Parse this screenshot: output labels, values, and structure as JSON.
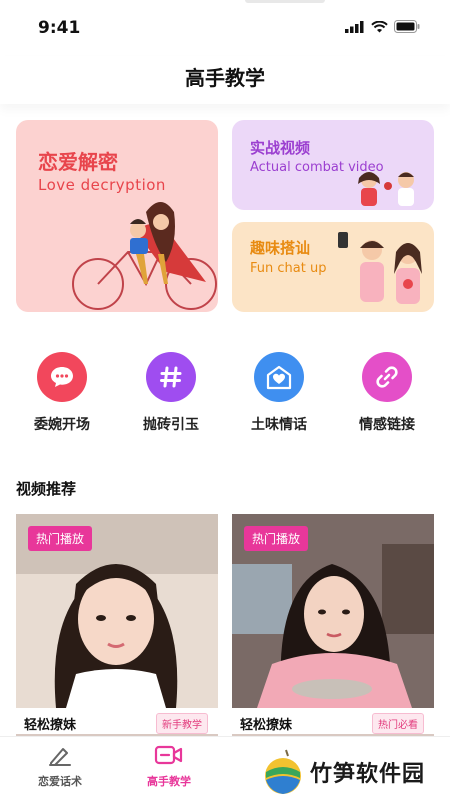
{
  "status": {
    "time": "9:41"
  },
  "header": {
    "title": "高手教学"
  },
  "cards": {
    "main": {
      "title": "恋爱解密",
      "subtitle": "Love decryption"
    },
    "video": {
      "title": "实战视频",
      "subtitle": "Actual combat video"
    },
    "chat": {
      "title": "趣味搭讪",
      "subtitle": "Fun chat up"
    }
  },
  "categories": [
    {
      "label": "委婉开场",
      "icon": "chat-bubble-icon",
      "color": "#f2475c"
    },
    {
      "label": "抛砖引玉",
      "icon": "hashtag-icon",
      "color": "#9f4df0"
    },
    {
      "label": "土味情话",
      "icon": "heart-icon",
      "color": "#3f8ff0"
    },
    {
      "label": "情感链接",
      "icon": "link-icon",
      "color": "#e44fc8"
    }
  ],
  "section": {
    "title": "视频推荐"
  },
  "videos": [
    {
      "badge": "热门播放",
      "name": "轻松撩妹",
      "tag": "新手教学"
    },
    {
      "badge": "热门播放",
      "name": "轻松撩妹",
      "tag": "热门必看"
    }
  ],
  "tabs": [
    {
      "label": "恋爱话术",
      "active": false
    },
    {
      "label": "高手教学",
      "active": true
    }
  ],
  "watermark": {
    "text": "竹笋软件园"
  },
  "colors": {
    "accent": "#e8379a",
    "active_tab": "#e8379a",
    "inactive_tab": "#555555"
  }
}
